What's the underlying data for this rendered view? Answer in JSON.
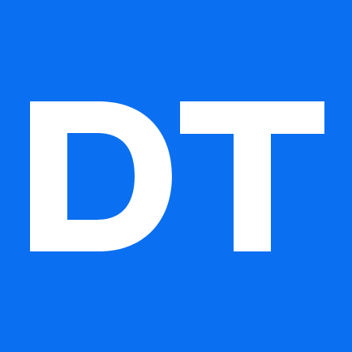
{
  "logo": {
    "text": "DT",
    "background_color": "#0a6ff1",
    "text_color": "#ffffff"
  }
}
